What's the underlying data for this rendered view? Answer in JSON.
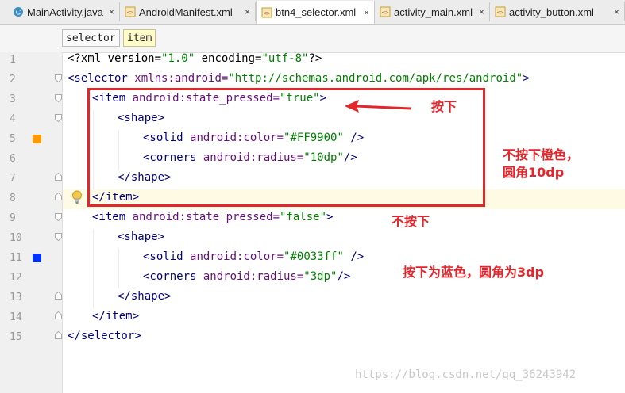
{
  "tabs": [
    {
      "label": "MainActivity.java",
      "icon": "java-class-icon",
      "active": false
    },
    {
      "label": "AndroidManifest.xml",
      "icon": "xml-file-icon",
      "active": false
    },
    {
      "label": "btn4_selector.xml",
      "icon": "xml-file-icon",
      "active": true
    },
    {
      "label": "activity_main.xml",
      "icon": "xml-file-icon",
      "active": false
    },
    {
      "label": "activity_button.xml",
      "icon": "xml-file-icon",
      "active": false
    }
  ],
  "close_glyph": "×",
  "breadcrumb": [
    "selector",
    "item"
  ],
  "line_numbers": [
    "1",
    "2",
    "3",
    "4",
    "5",
    "6",
    "7",
    "8",
    "9",
    "10",
    "11",
    "12",
    "13",
    "14",
    "15"
  ],
  "code": {
    "l1": {
      "a": "<?xml version=",
      "b": "\"1.0\"",
      "c": " encoding=",
      "d": "\"utf-8\"",
      "e": "?>"
    },
    "l2": {
      "a": "<selector ",
      "b": "xmlns:android=",
      "c": "\"http://schemas.android.com/apk/res/android\"",
      "d": ">"
    },
    "l3": {
      "a": "<item ",
      "b": "android:state_pressed=",
      "c": "\"true\"",
      "d": ">"
    },
    "l4": {
      "a": "<shape>"
    },
    "l5": {
      "a": "<solid ",
      "b": "android:color=",
      "c": "\"#FF9900\"",
      "d": " />"
    },
    "l6": {
      "a": "<corners ",
      "b": "android:radius=",
      "c": "\"10dp\"",
      "d": "/>"
    },
    "l7": {
      "a": "</shape>"
    },
    "l8": {
      "a": "</item>"
    },
    "l9": {
      "a": "<item ",
      "b": "android:state_pressed=",
      "c": "\"false\"",
      "d": ">"
    },
    "l10": {
      "a": "<shape>"
    },
    "l11": {
      "a": "<solid ",
      "b": "android:color=",
      "c": "\"#0033ff\"",
      "d": " />"
    },
    "l12": {
      "a": "<corners ",
      "b": "android:radius=",
      "c": "\"3dp\"",
      "d": "/>"
    },
    "l13": {
      "a": "</shape>"
    },
    "l14": {
      "a": "</item>"
    },
    "l15": {
      "a": "</selector>"
    }
  },
  "annotations": {
    "pressed": "按下",
    "not_pressed_desc_line1": "不按下橙色，",
    "not_pressed_desc_line2": "圆角10dp",
    "not_pressed": "不按下",
    "pressed_desc": "按下为蓝色，圆角为3dp"
  },
  "watermark": "https://blog.csdn.net/qq_36243942",
  "colors": {
    "orange_swatch": "#FF9900",
    "blue_swatch": "#0033ff",
    "annotation_red": "#e2262b"
  }
}
